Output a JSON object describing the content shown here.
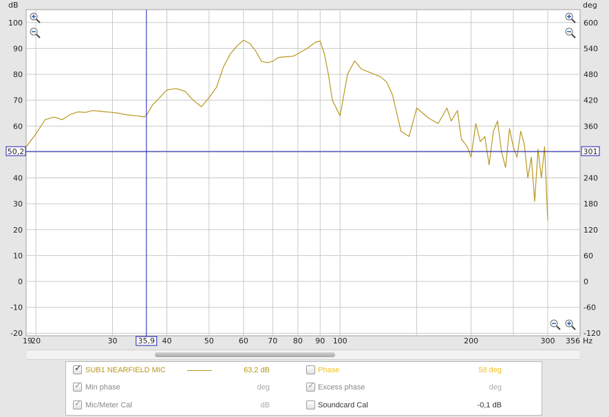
{
  "axes": {
    "left_unit": "dB",
    "right_unit": "deg",
    "x_unit": "Hz",
    "y_ticks": [
      100,
      90,
      80,
      70,
      60,
      50,
      40,
      30,
      20,
      10,
      0,
      -10,
      -20
    ],
    "phase_ticks": [
      600,
      540,
      480,
      420,
      360,
      300,
      240,
      180,
      120,
      60,
      0,
      -60,
      -120
    ],
    "x_ticks": [
      {
        "v": 19,
        "label": "19"
      },
      {
        "v": 20,
        "label": "20"
      },
      {
        "v": 30,
        "label": "30"
      },
      {
        "v": 40,
        "label": "40"
      },
      {
        "v": 50,
        "label": "50"
      },
      {
        "v": 60,
        "label": "60"
      },
      {
        "v": 70,
        "label": "70"
      },
      {
        "v": 80,
        "label": "80"
      },
      {
        "v": 90,
        "label": "90"
      },
      {
        "v": 100,
        "label": "100"
      },
      {
        "v": 200,
        "label": "200"
      },
      {
        "v": 300,
        "label": "300"
      },
      {
        "v": 356,
        "label": "356"
      }
    ],
    "x_minor_grid": [
      150,
      250
    ],
    "y_range": [
      -21,
      105
    ],
    "phase_range": [
      -126,
      630
    ],
    "x_range": [
      19,
      356
    ],
    "log_x": true
  },
  "cursor": {
    "freq": 35.9,
    "freq_label": "35,9",
    "level": 50.2,
    "level_label": "50,2",
    "phase_label": "301",
    "color": "#1c1cb4"
  },
  "colors": {
    "trace": "#b8961c",
    "phase": "#f0c020",
    "cursor": "#1c1cb4"
  },
  "chart_data": {
    "type": "line",
    "series": [
      {
        "name": "SUB1 NEARFIELD MIC",
        "x": [
          19,
          20,
          21,
          22,
          23,
          24,
          25,
          26,
          27,
          28,
          29,
          30,
          31,
          32,
          33,
          34,
          34.8,
          35.5,
          36,
          37,
          38,
          39,
          40,
          42,
          44,
          46,
          48,
          50,
          52,
          54,
          56,
          58,
          60,
          62,
          64,
          66,
          68,
          70,
          72,
          75,
          78,
          80,
          84,
          88,
          90,
          92,
          94,
          96,
          100,
          104,
          108,
          112,
          116,
          120,
          124,
          128,
          132,
          138,
          144,
          150,
          160,
          168,
          172,
          176,
          180,
          186,
          190,
          196,
          200,
          205,
          210,
          215,
          220,
          225,
          230,
          235,
          240,
          245,
          250,
          255,
          260,
          265,
          270,
          275,
          280,
          285,
          290,
          295,
          300
        ],
        "y": [
          52,
          57,
          62.5,
          63.5,
          62.5,
          64.5,
          65.5,
          65.3,
          66,
          65.8,
          65.5,
          65.3,
          65,
          64.5,
          64.2,
          64,
          63.8,
          63.5,
          64.5,
          68,
          70,
          72,
          74,
          74.5,
          73.5,
          70,
          67.5,
          71,
          75,
          83,
          88,
          91,
          93.2,
          92,
          89,
          85,
          84.5,
          85,
          86.5,
          86.8,
          87,
          88,
          90,
          92.5,
          92.8,
          88,
          80,
          70,
          64,
          80,
          85.2,
          82,
          81,
          80,
          79,
          77,
          72,
          58,
          56,
          67,
          63,
          61,
          64,
          67,
          62,
          66,
          55,
          52,
          48,
          61,
          54,
          56,
          45,
          58,
          62,
          50,
          44,
          59,
          52,
          48,
          58,
          53,
          40,
          48,
          31,
          51,
          40,
          52,
          23.5
        ]
      }
    ]
  },
  "legend": {
    "rows": [
      {
        "label": "SUB1 NEARFIELD MIC",
        "value": "63,2 dB",
        "checked": true
      },
      {
        "label": "Min phase",
        "value": "deg",
        "checked": true
      },
      {
        "label": "Mic/Meter Cal",
        "value": "dB",
        "checked": true
      },
      {
        "label": "Phase",
        "value": "58 deg",
        "checked": false
      },
      {
        "label": "Excess phase",
        "value": "deg",
        "checked": true
      },
      {
        "label": "Soundcard Cal",
        "value": "-0,1 dB",
        "checked": false
      }
    ]
  }
}
